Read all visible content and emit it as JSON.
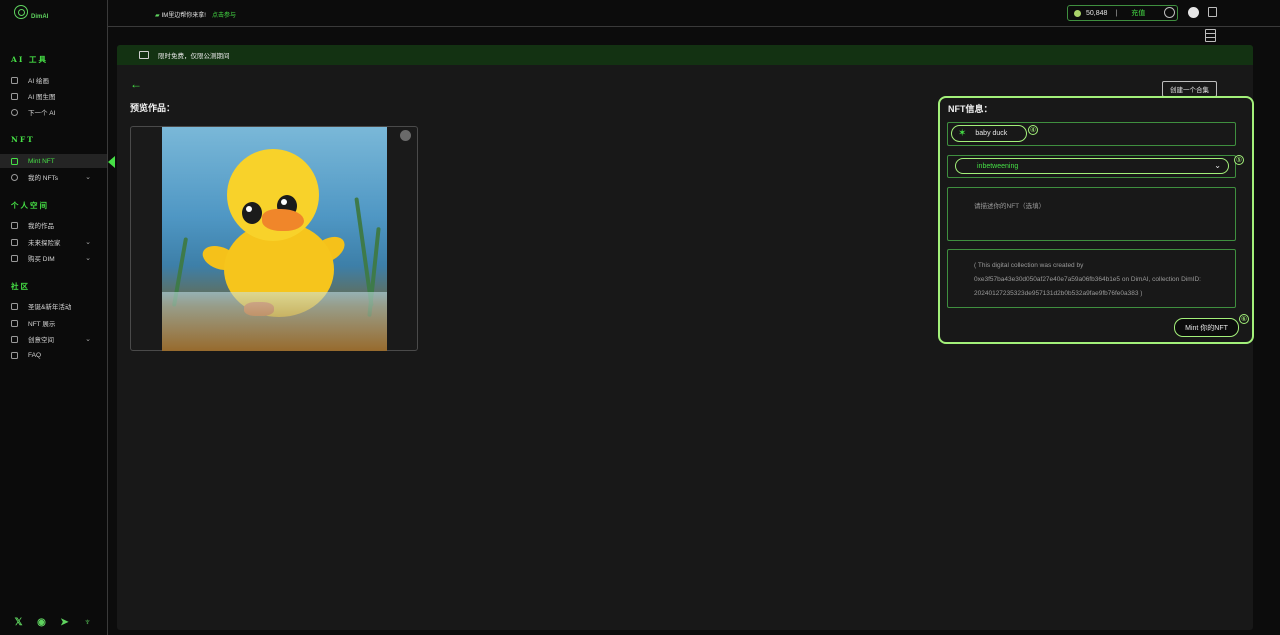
{
  "brand": {
    "name": "DimAI"
  },
  "header": {
    "notice": "IM里边帮你来拿!",
    "notice_link": "点击参与",
    "balance": "50,848",
    "balance_sep": "|",
    "recharge": "充值"
  },
  "sidebar": {
    "sections": [
      {
        "title": "AI 工具"
      },
      {
        "title": "NFT"
      },
      {
        "title": "个人空间"
      },
      {
        "title": "社区"
      }
    ],
    "items": [
      {
        "label": "AI 绘画"
      },
      {
        "label": "AI 图生图"
      },
      {
        "label": "下一个 AI"
      },
      {
        "label": "Mint NFT"
      },
      {
        "label": "我的 NFTs"
      },
      {
        "label": "我的作品"
      },
      {
        "label": "未来探险家"
      },
      {
        "label": "购买 DIM"
      },
      {
        "label": "圣诞&新年活动"
      },
      {
        "label": "NFT 展示"
      },
      {
        "label": "创意空间"
      },
      {
        "label": "FAQ"
      }
    ],
    "social": [
      "X",
      "discord",
      "telegram",
      "podcast"
    ]
  },
  "main": {
    "banner": "限时免费，仅限公测期间",
    "preview_title": "预览作品：",
    "create_collection": "创建一个合集"
  },
  "nft": {
    "title": "NFT信息：",
    "name_value": "baby duck",
    "collection_value": "inbetweening",
    "description_placeholder": "请描述你的NFT（选填）",
    "credit_text": "( This digital collection was created by 0xe3f57ba43e30d050af27e40e7a59a06fb364b1e5 on DimAI, collection DimID: 20240127235323de957131d2b0b532a9fae9fb76fe0a383 )",
    "mint_label": "Mint 你的NFT",
    "markers": [
      "④",
      "⑤",
      "⑥"
    ]
  }
}
